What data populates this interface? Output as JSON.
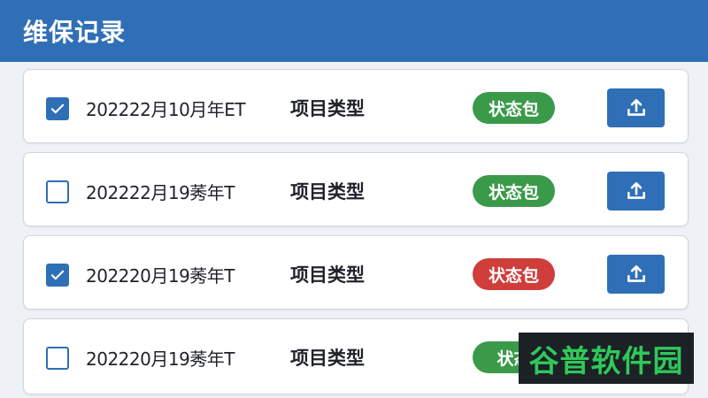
{
  "header": {
    "title": "维保记录"
  },
  "rows": [
    {
      "checked": true,
      "date": "202222月10月年ET",
      "type": "项目类型",
      "status": "状态包",
      "status_color": "green",
      "upload_icon": "upload-icon"
    },
    {
      "checked": false,
      "date": "202222月19莠年T",
      "type": "项目类型",
      "status": "状态包",
      "status_color": "green",
      "upload_icon": "upload-icon"
    },
    {
      "checked": true,
      "date": "202220月19莠年T",
      "type": "项目类型",
      "status": "状态包",
      "status_color": "red",
      "upload_icon": "upload-icon"
    },
    {
      "checked": false,
      "date": "202220月19莠年T",
      "type": "项目类型",
      "status": "状态",
      "status_color": "green",
      "upload_icon": "upload-icon"
    }
  ],
  "colors": {
    "primary": "#2f6fb6",
    "green": "#3a9a4a",
    "red": "#cf3e3a"
  },
  "watermark": {
    "text": "谷普软件园"
  }
}
